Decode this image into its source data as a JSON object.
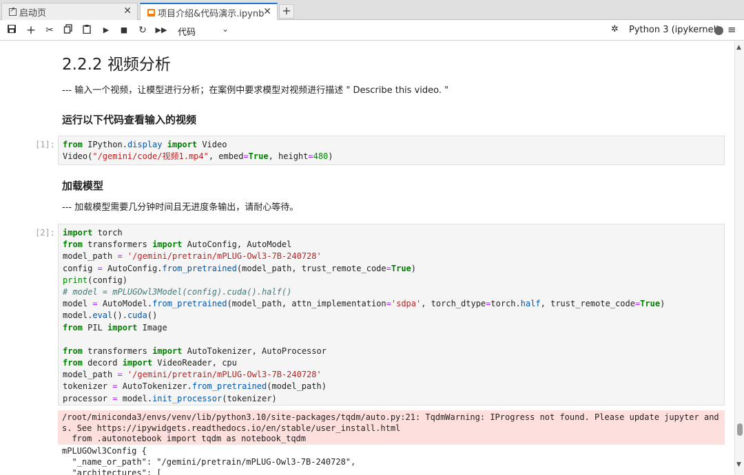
{
  "tabs": [
    {
      "label": "启动页",
      "icon": "external-link-icon",
      "active": false
    },
    {
      "label": "项目介绍&代码演示.ipynb",
      "icon": "notebook-icon",
      "active": true
    }
  ],
  "toolbar": {
    "cell_type": "代码",
    "kernel_name": "Python 3 (ipykernel)"
  },
  "notebook": {
    "heading": "2.2.2 视频分析",
    "intro": "--- 输入一个视频，让模型进行分析；在案例中要求模型对视频进行描述 \" Describe this video. \"",
    "section1_title": "运行以下代码查看输入的视频",
    "cell1": {
      "prompt": "[1]:",
      "lines": [
        "from IPython.display import Video",
        "Video(\"/gemini/code/视频1.mp4\", embed=True, height=480)"
      ]
    },
    "section2_title": "加载模型",
    "section2_note": "--- 加载模型需要几分钟时间且无进度条输出，请耐心等待。",
    "cell2": {
      "prompt": "[2]:",
      "lines": [
        "import torch",
        "from transformers import AutoConfig, AutoModel",
        "model_path = '/gemini/pretrain/mPLUG-Owl3-7B-240728'",
        "config = AutoConfig.from_pretrained(model_path, trust_remote_code=True)",
        "print(config)",
        "# model = mPLUGOwl3Model(config).cuda().half()",
        "model = AutoModel.from_pretrained(model_path, attn_implementation='sdpa', torch_dtype=torch.half, trust_remote_code=True)",
        "model.eval().cuda()",
        "from PIL import Image",
        "",
        "from transformers import AutoTokenizer, AutoProcessor",
        "from decord import VideoReader, cpu",
        "model_path = '/gemini/pretrain/mPLUG-Owl3-7B-240728'",
        "tokenizer = AutoTokenizer.from_pretrained(model_path)",
        "processor = model.init_processor(tokenizer)"
      ]
    },
    "stderr_lines": [
      "/root/miniconda3/envs/venv/lib/python3.10/site-packages/tqdm/auto.py:21: TqdmWarning: IProgress not found. Please update jupyter and ipywidget",
      "s. See https://ipywidgets.readthedocs.io/en/stable/user_install.html",
      "  from .autonotebook import tqdm as notebook_tqdm"
    ],
    "stdout_lines": [
      "mPLUGOwl3Config {",
      "  \"_name_or_path\": \"/gemini/pretrain/mPLUG-Owl3-7B-240728\",",
      "  \"architectures\": ["
    ]
  }
}
